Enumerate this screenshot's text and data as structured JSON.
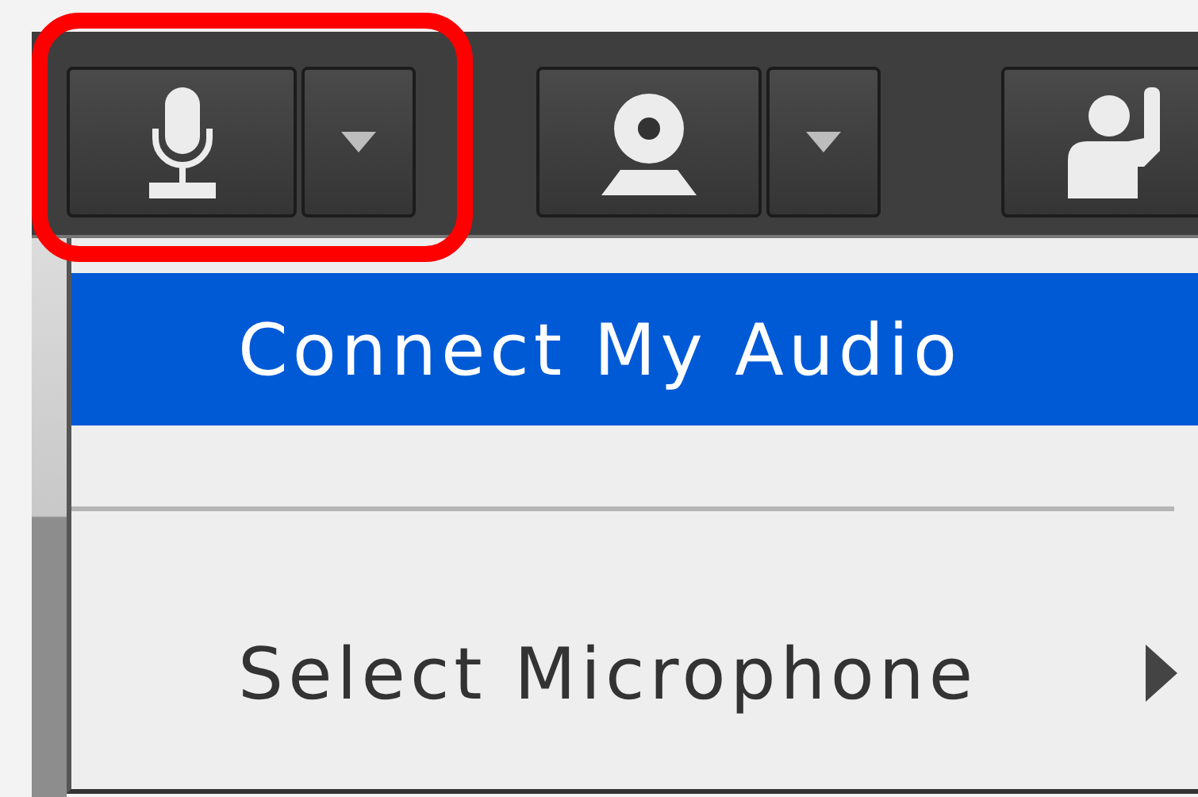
{
  "toolbar": {
    "buttons": [
      {
        "kind": "microphone",
        "dropdown": true,
        "highlighted": true
      },
      {
        "kind": "webcam",
        "dropdown": true,
        "highlighted": false
      },
      {
        "kind": "hand",
        "dropdown": false,
        "highlighted": false
      }
    ]
  },
  "menu": {
    "items": [
      {
        "kind": "item",
        "label": "Connect My Audio",
        "selected": true
      },
      {
        "kind": "separator"
      },
      {
        "kind": "submenu",
        "label": "Select Microphone",
        "selected": false
      }
    ]
  }
}
